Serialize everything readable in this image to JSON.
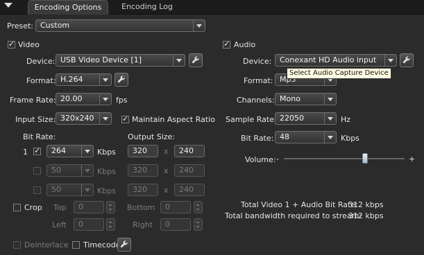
{
  "tabs": [
    {
      "label": "Encoding Options",
      "active": true
    },
    {
      "label": "Encoding Log",
      "active": false
    }
  ],
  "preset": {
    "label": "Preset:",
    "value": "Custom"
  },
  "video": {
    "section_label": "Video",
    "enabled": true,
    "device": {
      "label": "Device:",
      "value": "USB Video Device [1]"
    },
    "format": {
      "label": "Format:",
      "value": "H.264"
    },
    "frame_rate": {
      "label": "Frame Rate:",
      "value": "20.00",
      "unit": "fps"
    },
    "input_size": {
      "label": "Input Size:",
      "value": "320x240"
    },
    "maintain_aspect": {
      "label": "Maintain Aspect Ratio",
      "checked": true
    },
    "bit_rate_label": "Bit Rate:",
    "output_size_label": "Output Size:",
    "streams": [
      {
        "index": "1",
        "enabled": true,
        "bitrate": "264",
        "unit": "Kbps",
        "width": "320",
        "x": "x",
        "height": "240"
      },
      {
        "index": "",
        "enabled": false,
        "bitrate": "50",
        "unit": "Kbps",
        "width": "320",
        "x": "x",
        "height": "240"
      },
      {
        "index": "",
        "enabled": false,
        "bitrate": "50",
        "unit": "Kbps",
        "width": "320",
        "x": "x",
        "height": "240"
      }
    ],
    "crop": {
      "label": "Crop",
      "enabled": false,
      "top_label": "Top",
      "top": "0",
      "bottom_label": "Bottom",
      "bottom": "0",
      "left_label": "Left",
      "left": "0",
      "right_label": "Right",
      "right": "0"
    },
    "deinterlace": {
      "label": "Deinterlace",
      "enabled": false
    },
    "timecode": {
      "label": "Timecode",
      "enabled": false
    }
  },
  "audio": {
    "section_label": "Audio",
    "enabled": true,
    "device": {
      "label": "Device:",
      "value": "Conexant HD Audio input"
    },
    "tooltip": "Select Audio Capture Device",
    "format": {
      "label": "Format:",
      "value": "Mp3"
    },
    "channels": {
      "label": "Channels:",
      "value": "Mono"
    },
    "sample_rate": {
      "label": "Sample Rate:",
      "value": "22050",
      "unit": "Hz"
    },
    "bit_rate": {
      "label": "Bit Rate:",
      "value": "48",
      "unit": "Kbps"
    },
    "volume": {
      "label": "Volume:",
      "minus": "-",
      "plus": "+",
      "level": 0.68
    }
  },
  "summary": {
    "total_bitrate_label": "Total Video 1 + Audio Bit Rate:",
    "total_bitrate_value": "312 kbps",
    "bandwidth_label": "Total bandwidth required to stream:",
    "bandwidth_value": "312 kbps"
  },
  "colors": {
    "background": "#2b2b2b",
    "tooltip_bg": "#fffbe1"
  },
  "icons": {
    "menu": "chevron-down-icon",
    "config": "wrench-icon"
  }
}
